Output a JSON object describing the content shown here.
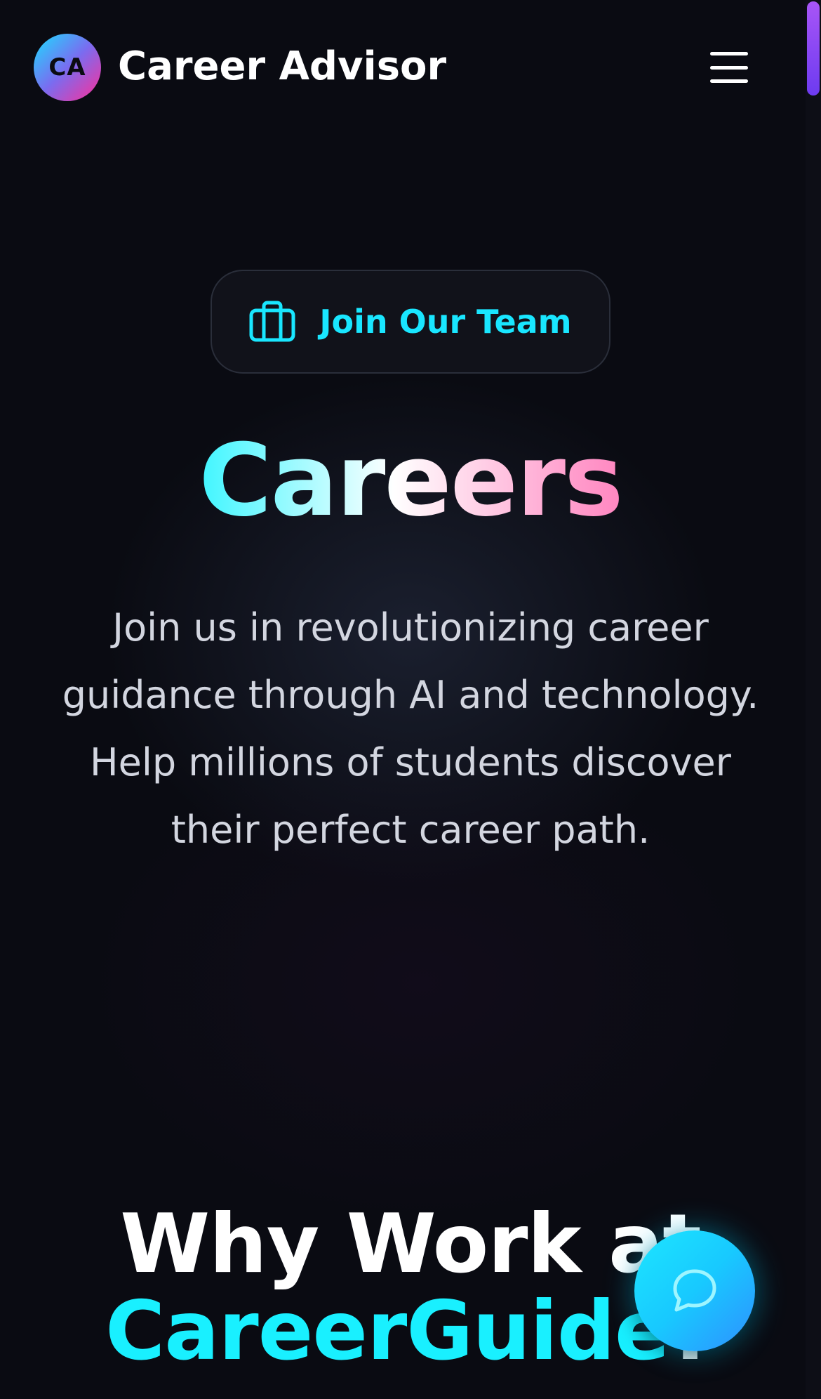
{
  "header": {
    "logo_text": "CA",
    "brand": "Career Advisor",
    "menu_icon": "hamburger-menu-icon"
  },
  "hero": {
    "badge_icon": "briefcase-icon",
    "badge_label": "Join Our Team",
    "title": "Careers",
    "description": "Join us in revolutionizing career guidance through AI and technology. Help millions of students discover their perfect career path."
  },
  "why_section": {
    "title_prefix": "Why Work at",
    "title_accent": "CareerGuide",
    "title_suffix": "?"
  },
  "chat": {
    "icon": "chat-bubble-icon"
  },
  "colors": {
    "background": "#0a0b12",
    "accent_cyan": "#19e6ff",
    "accent_pink": "#ff2a8e",
    "scrollbar_thumb": "#a855f7"
  }
}
